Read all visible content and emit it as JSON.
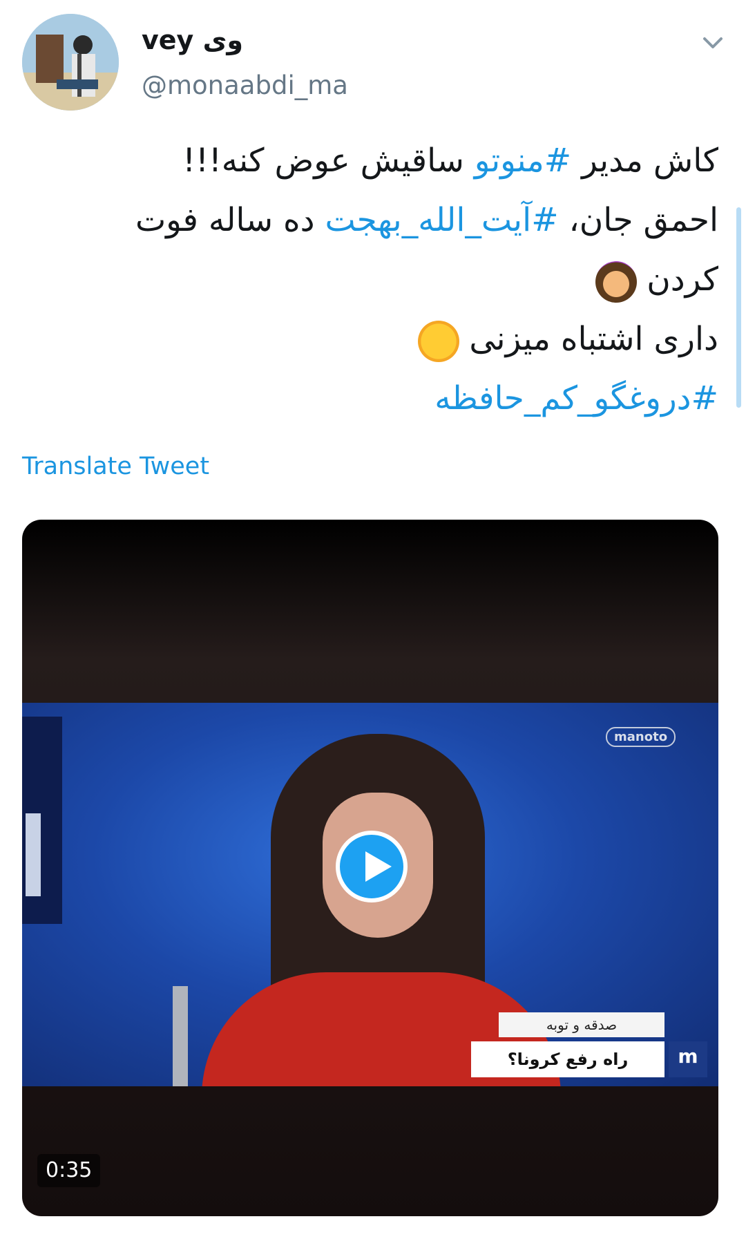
{
  "tweet": {
    "display_name_latin": "vey",
    "display_name_persian": "وی",
    "handle": "@monaabdi_ma",
    "text_lines": [
      {
        "before": "کاش مدیر ",
        "hashtag": "#منوتو",
        "after": " ساقیش عوض کنه!!!"
      },
      {
        "before": "احمق جان، ",
        "hashtag": "#آیت_الله_بهجت",
        "after": "  ده ساله فوت"
      },
      {
        "before": "کردن",
        "emoji": "face-palm"
      },
      {
        "before": "داری اشتباه میزنی",
        "emoji": "tears-of-joy"
      },
      {
        "hashtag": "#دروغگو_کم_حافظه"
      }
    ],
    "translate_label": "Translate Tweet"
  },
  "video": {
    "channel_logo": "manoto",
    "caption_top": "صدقه و توبه",
    "caption_main": "راه رفع کرونا؟",
    "caption_logo": "m",
    "duration": "0:35"
  },
  "colors": {
    "link": "#1b95e0",
    "play_button": "#1da1f2",
    "text": "#14171a",
    "handle": "#657786"
  }
}
